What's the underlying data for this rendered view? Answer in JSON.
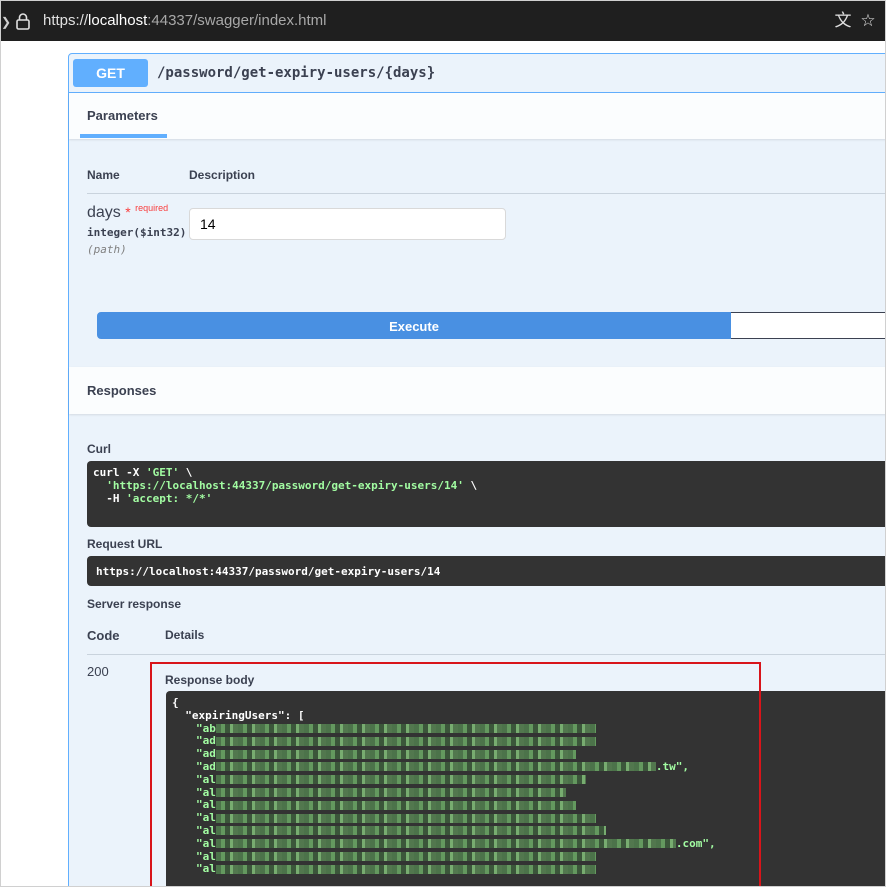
{
  "browser": {
    "url_scheme": "https://",
    "url_host": "localhost",
    "url_rest": ":44337/swagger/index.html",
    "icons": [
      "lock-icon",
      "translate-icon",
      "star-icon"
    ]
  },
  "operation": {
    "method": "GET",
    "path": "/password/get-expiry-users/{days}"
  },
  "parameters": {
    "tab_label": "Parameters",
    "col_name": "Name",
    "col_description": "Description",
    "name": "days",
    "required_mark": "*",
    "required_label": "required",
    "type": "integer($int32)",
    "location": "(path)",
    "value": "14"
  },
  "execute_label": "Execute",
  "responses": {
    "title": "Responses",
    "curl_label": "Curl",
    "curl_line1": "curl -X ",
    "curl_method": "'GET'",
    "curl_line1_end": " \\",
    "curl_url": "'https://localhost:44337/password/get-expiry-users/14'",
    "curl_url_end": " \\",
    "curl_line3_prefix": "  -H ",
    "curl_header": "'accept: */*'",
    "request_url_label": "Request URL",
    "request_url": "https://localhost:44337/password/get-expiry-users/14",
    "server_response_label": "Server response",
    "col_code": "Code",
    "col_details": "Details",
    "code": "200",
    "body_label": "Response body",
    "body_open": "{",
    "body_key": "  \"expiringUsers\": [",
    "body_items": [
      {
        "prefix": "\"ab",
        "suffix": ""
      },
      {
        "prefix": "\"ad",
        "suffix": ""
      },
      {
        "prefix": "\"ad",
        "suffix": ""
      },
      {
        "prefix": "\"ad",
        "suffix": ".tw\","
      },
      {
        "prefix": "\"al",
        "suffix": ""
      },
      {
        "prefix": "\"al",
        "suffix": ""
      },
      {
        "prefix": "\"al",
        "suffix": ""
      },
      {
        "prefix": "\"al",
        "suffix": ""
      },
      {
        "prefix": "\"al",
        "suffix": ""
      },
      {
        "prefix": "\"al",
        "suffix": ".com\","
      },
      {
        "prefix": "\"al",
        "suffix": ""
      },
      {
        "prefix": "\"al",
        "suffix": ""
      }
    ]
  },
  "colors": {
    "get_blue": "#61affe",
    "execute_blue": "#4990e2",
    "code_bg": "#333333",
    "string_green": "#a2fca2",
    "highlight_red": "#d8141a"
  }
}
